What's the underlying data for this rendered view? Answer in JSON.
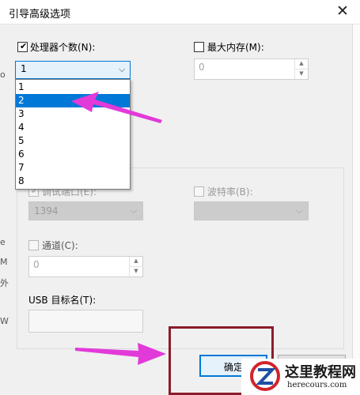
{
  "window": {
    "title": "引导高级选项",
    "close_glyph": "✕"
  },
  "processor": {
    "checkbox_label": "处理器个数(N):",
    "checked": true,
    "selected_value": "1",
    "options": [
      "1",
      "2",
      "3",
      "4",
      "5",
      "6",
      "7",
      "8"
    ],
    "highlighted_option": "2"
  },
  "max_memory": {
    "checkbox_label": "最大内存(M):",
    "checked": false,
    "value": "0"
  },
  "debug_group": {
    "port_label": "调试端口(E):",
    "port_value": "1394",
    "baud_label": "波特率(B):",
    "channel_label": "通道(C):",
    "channel_value": "0",
    "usb_label": "USB 目标名(T):"
  },
  "buttons": {
    "ok_label": "确定"
  },
  "watermark": {
    "cn_text": "这里教程网",
    "url_text": "herecours.com"
  },
  "annotation_color": "#e23ad9",
  "background_fragments": [
    "o",
    "e",
    "M",
    "外",
    "W"
  ]
}
